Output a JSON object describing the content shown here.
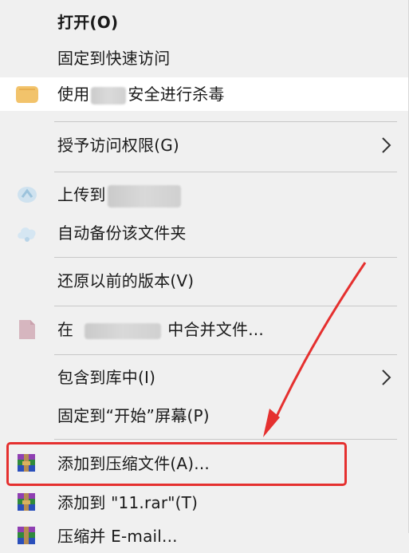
{
  "menu": {
    "items": [
      {
        "label": "打开(O)",
        "bold": true
      },
      {
        "label": "固定到快速访问"
      },
      {
        "label_prefix": "使用",
        "label_suffix": "安全进行杀毒",
        "icon": "antivirus-shield-icon"
      },
      {
        "label": "授予访问权限(G)",
        "submenu": true
      },
      {
        "label_prefix": "上传到",
        "icon": "cloud-upload-icon"
      },
      {
        "label": "自动备份该文件夹",
        "icon": "cloud-backup-icon"
      },
      {
        "label": "还原以前的版本(V)"
      },
      {
        "label_prefix": "在",
        "label_suffix": "中合并文件...",
        "icon": "pdf-merge-icon"
      },
      {
        "label": "包含到库中(I)",
        "submenu": true
      },
      {
        "label": "固定到“开始”屏幕(P)"
      },
      {
        "label": "添加到压缩文件(A)...",
        "icon": "winrar-archive-icon"
      },
      {
        "label": "添加到 \"11.rar\"(T)",
        "icon": "winrar-archive-icon"
      },
      {
        "label": "压缩并 E-mail...",
        "icon": "winrar-archive-icon"
      }
    ]
  },
  "colors": {
    "menu_bg": "#f0f0f0",
    "separator": "#c8c8c8",
    "annotation_red": "#e5302f",
    "highlight_bg": "#ffffff"
  }
}
